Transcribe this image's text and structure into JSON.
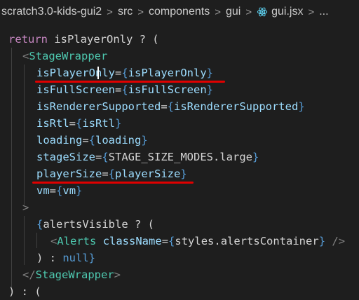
{
  "breadcrumb": {
    "items": [
      "scratch3.0-kids-gui2",
      "src",
      "components",
      "gui",
      "gui.jsx",
      "..."
    ]
  },
  "icons": {
    "file": "react-icon"
  },
  "colors": {
    "underline": "#e00000"
  },
  "code": {
    "l1": [
      "return",
      " isPlayerOnly ? ("
    ],
    "l2": [
      "<",
      "StageWrapper"
    ],
    "l3": [
      "isPlayerOnly",
      "=",
      "{",
      "isPlayerOnly",
      "}"
    ],
    "l4": [
      "isFullScreen",
      "=",
      "{",
      "isFullScreen",
      "}"
    ],
    "l5": [
      "isRendererSupported",
      "=",
      "{",
      "isRendererSupported",
      "}"
    ],
    "l6": [
      "isRtl",
      "=",
      "{",
      "isRtl",
      "}"
    ],
    "l7": [
      "loading",
      "=",
      "{",
      "loading",
      "}"
    ],
    "l8": [
      "stageSize",
      "=",
      "{",
      "STAGE_SIZE_MODES.large",
      "}"
    ],
    "l9": [
      "playerSize",
      "=",
      "{",
      "playerSize",
      "}"
    ],
    "l10": [
      "vm",
      "=",
      "{",
      "vm",
      "}"
    ],
    "l11": [
      ">"
    ],
    "l12": [
      "{",
      "alertsVisible ? ("
    ],
    "l13": [
      "<",
      "Alerts",
      " ",
      "className",
      "=",
      "{",
      "styles.alertsContainer",
      "}",
      " />"
    ],
    "l14": [
      ") : ",
      "null",
      "}"
    ],
    "l15": [
      "</",
      "StageWrapper",
      ">"
    ],
    "l16": [
      ") : ("
    ]
  }
}
